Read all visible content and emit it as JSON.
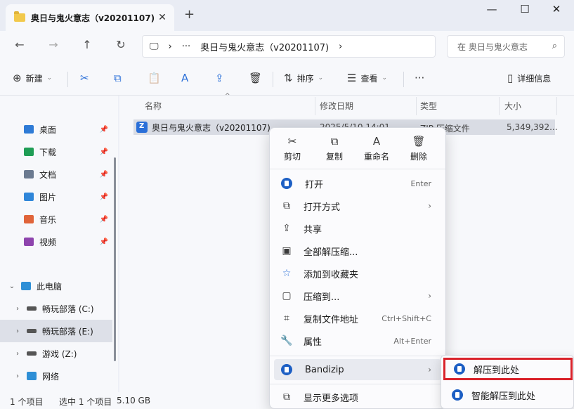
{
  "tab": {
    "title": "奥日与鬼火意志（v20201107)",
    "close": "✕",
    "new": "+"
  },
  "window": {
    "minimize": "—",
    "maximize": "☐",
    "close": "✕"
  },
  "nav": {
    "back": "←",
    "forward": "→",
    "up": "↑",
    "refresh": "↻"
  },
  "address": {
    "monitor_icon": "🖵",
    "chevron": "›",
    "more": "···",
    "path": "奥日与鬼火意志（v20201107)",
    "end_chevron": "›"
  },
  "search": {
    "placeholder": "在 奥日与鬼火意志",
    "icon": "⌕"
  },
  "toolbar": {
    "new_label": "新建",
    "new_icon": "⊕",
    "cut_icon": "✂",
    "copy_icon": "⧉",
    "paste_icon": "📋",
    "rename_icon": "A",
    "share_icon": "⇪",
    "delete_icon": "🗑",
    "sort_label": "排序",
    "sort_icon": "⇅",
    "view_label": "查看",
    "view_icon": "☰",
    "more_icon": "···",
    "details_label": "详细信息",
    "details_icon": "▯"
  },
  "sidebar": {
    "quick": [
      {
        "label": "桌面",
        "color": "#2e7bd6",
        "pin": "📌"
      },
      {
        "label": "下载",
        "color": "#1f9d55",
        "pin": "📌"
      },
      {
        "label": "文档",
        "color": "#6b7a90",
        "pin": "📌"
      },
      {
        "label": "图片",
        "color": "#2f86d9",
        "pin": "📌"
      },
      {
        "label": "音乐",
        "color": "#e0643a",
        "pin": "📌"
      },
      {
        "label": "视频",
        "color": "#8e44ad",
        "pin": "📌"
      }
    ],
    "pc": {
      "label": "此电脑",
      "chev": "⌄"
    },
    "drives": [
      {
        "label": "畅玩部落 (C:)",
        "chev": "›"
      },
      {
        "label": "畅玩部落 (E:)",
        "chev": "›"
      },
      {
        "label": "游戏 (Z:)",
        "chev": "›"
      }
    ],
    "network": {
      "label": "网络",
      "chev": "›"
    }
  },
  "columns": {
    "name": "名称",
    "date": "修改日期",
    "type": "类型",
    "size": "大小",
    "sort_arrow": "^"
  },
  "file": {
    "name": "奥日与鬼火意志（v20201107)",
    "date": "2025/5/10 14:01",
    "type": "ZIP 压缩文件",
    "size": "5,349,392..."
  },
  "status": {
    "count": "1 个项目",
    "selected": "选中 1 个项目",
    "size": "5.10 GB"
  },
  "context_menu": {
    "quick": [
      {
        "label": "剪切",
        "icon": "✂"
      },
      {
        "label": "复制",
        "icon": "⧉"
      },
      {
        "label": "重命名",
        "icon": "A"
      },
      {
        "label": "删除",
        "icon": "🗑"
      }
    ],
    "items": {
      "open": {
        "label": "打开",
        "shortcut": "Enter"
      },
      "open_with": {
        "label": "打开方式",
        "icon": "⧉",
        "arrow": "›"
      },
      "share": {
        "label": "共享",
        "icon": "⇪"
      },
      "extract_all": {
        "label": "全部解压缩...",
        "icon": "▣"
      },
      "favorite": {
        "label": "添加到收藏夹",
        "icon": "☆"
      },
      "compress": {
        "label": "压缩到...",
        "icon": "▢",
        "arrow": "›"
      },
      "copy_path": {
        "label": "复制文件地址",
        "icon": "⌗",
        "shortcut": "Ctrl+Shift+C"
      },
      "properties": {
        "label": "属性",
        "icon": "🔧",
        "shortcut": "Alt+Enter"
      },
      "bandizip": {
        "label": "Bandizip",
        "arrow": "›"
      },
      "more_options": {
        "label": "显示更多选项",
        "icon": "⧉"
      }
    }
  },
  "submenu": {
    "extract_here": "解压到此处",
    "smart_extract": "智能解压到此处"
  }
}
